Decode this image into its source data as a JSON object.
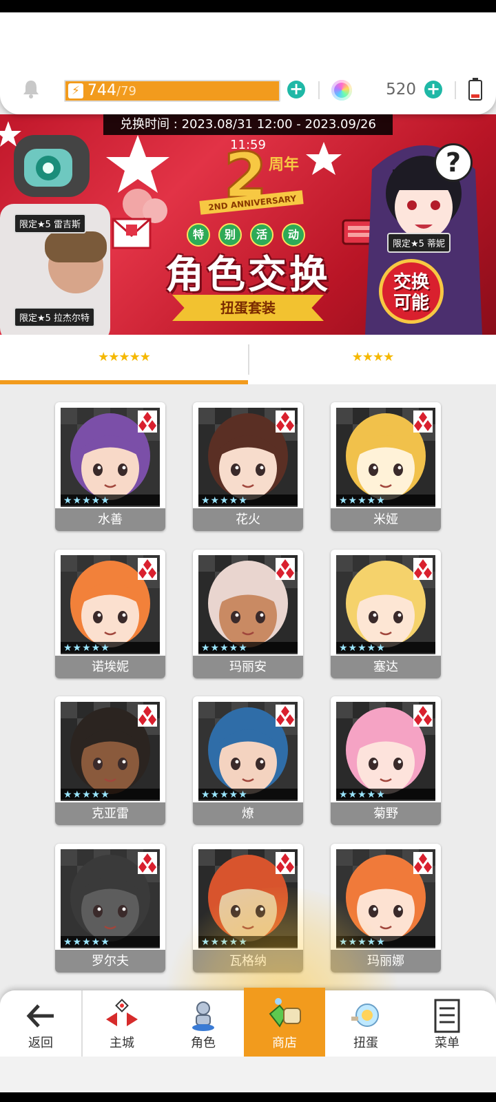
{
  "status": {
    "energy_current": "744",
    "energy_max": "/79",
    "gem_count": "520"
  },
  "banner": {
    "exchange_time": "兑换时间 : 2023.08/31 12:00 - 2023.09/26 11:59",
    "anniversary": "2周年",
    "anniversary_en": "2ND ANNIVERSARY",
    "event_chars": [
      "特",
      "别",
      "活",
      "动"
    ],
    "title": "角色交换",
    "subtitle": "扭蛋套装",
    "badge_line1": "交换",
    "badge_line2": "可能",
    "help": "?",
    "tags": {
      "left_top": "限定★5 雷吉斯",
      "left_bottom": "限定★5 拉杰尔特",
      "right": "限定★5 蒂妮"
    }
  },
  "tabs": [
    {
      "label": "★★★★★",
      "active": true
    },
    {
      "label": "★★★★",
      "active": false
    }
  ],
  "characters": [
    {
      "name": "水善",
      "stars": "★★★★★",
      "hair": "#7b4fa8",
      "skin": "#f8d9c8",
      "bg": "#333"
    },
    {
      "name": "花火",
      "stars": "★★★★★",
      "hair": "#5a2f24",
      "skin": "#f7dccc",
      "bg": "#2b2b2b"
    },
    {
      "name": "米娅",
      "stars": "★★★★★",
      "hair": "#f1c14b",
      "skin": "#fff2d8",
      "bg": "#2a2a2a"
    },
    {
      "name": "诺埃妮",
      "stars": "★★★★★",
      "hair": "#f2813a",
      "skin": "#fbe0cf",
      "bg": "#333"
    },
    {
      "name": "玛丽安",
      "stars": "★★★★★",
      "hair": "#e9d5cf",
      "skin": "#c98a63",
      "bg": "#2a2a2a"
    },
    {
      "name": "塞达",
      "stars": "★★★★★",
      "hair": "#f5d26b",
      "skin": "#fde6d4",
      "bg": "#333"
    },
    {
      "name": "克亚雷",
      "stars": "★★★★★",
      "hair": "#2b2420",
      "skin": "#8a5a3c",
      "bg": "#2a2a2a"
    },
    {
      "name": "燎",
      "stars": "★★★★★",
      "hair": "#2f6da8",
      "skin": "#f4d3c0",
      "bg": "#333"
    },
    {
      "name": "菊野",
      "stars": "★★★★★",
      "hair": "#f5a3c4",
      "skin": "#fde3dc",
      "bg": "#2a2a2a"
    },
    {
      "name": "罗尔夫",
      "stars": "★★★★★",
      "hair": "#3a3a3a",
      "skin": "#5d5d5d",
      "bg": "#333"
    },
    {
      "name": "瓦格纳",
      "stars": "★★★★★",
      "hair": "#d8542d",
      "skin": "#e6c8a0",
      "bg": "#2a2a2a"
    },
    {
      "name": "玛丽娜",
      "stars": "★★★★★",
      "hair": "#f07a3a",
      "skin": "#fde2d2",
      "bg": "#333"
    }
  ],
  "nav": [
    {
      "label": "返回",
      "icon": "back-arrow-icon"
    },
    {
      "label": "主城",
      "icon": "castle-icon"
    },
    {
      "label": "角色",
      "icon": "character-icon"
    },
    {
      "label": "商店",
      "icon": "shop-icon",
      "active": true
    },
    {
      "label": "扭蛋",
      "icon": "gacha-icon"
    },
    {
      "label": "菜单",
      "icon": "menu-icon"
    }
  ],
  "colors": {
    "accent_orange": "#f29b1d",
    "plus_teal": "#1fb8a6",
    "banner_red": "#c0172a",
    "card_name_gray": "#8e8e8e"
  }
}
